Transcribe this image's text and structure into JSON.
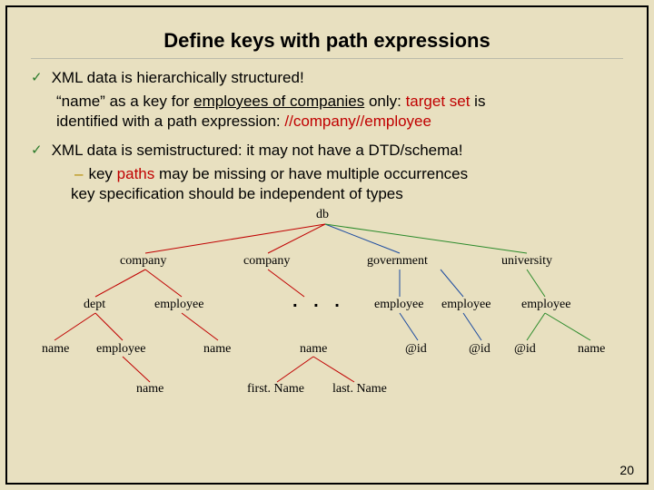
{
  "title": "Define keys with path expressions",
  "bullet1": {
    "line1": "XML data is hierarchically structured!",
    "line2_pre": "“name” as a key for ",
    "line2_u": "employees of companies",
    "line2_post": " only:  ",
    "target_set": "target set",
    "line2_end": " is",
    "line3_pre": "identified with a path expression: ",
    "path": "//company//employee"
  },
  "bullet2": {
    "line1": "XML data is semistructured: it may not have a DTD/schema!",
    "sub1_pre": "key ",
    "sub1_red": "paths",
    "sub1_post": " may be missing or have multiple occurrences",
    "sub2": "key specification should be independent of types"
  },
  "tree": {
    "db": "db",
    "company": "company",
    "government": "government",
    "university": "university",
    "dept": "dept",
    "employee": "employee",
    "name": "name",
    "atid": "@id",
    "firstName": "first. Name",
    "lastName": "last. Name",
    "dots": ". . ."
  },
  "page": "20"
}
